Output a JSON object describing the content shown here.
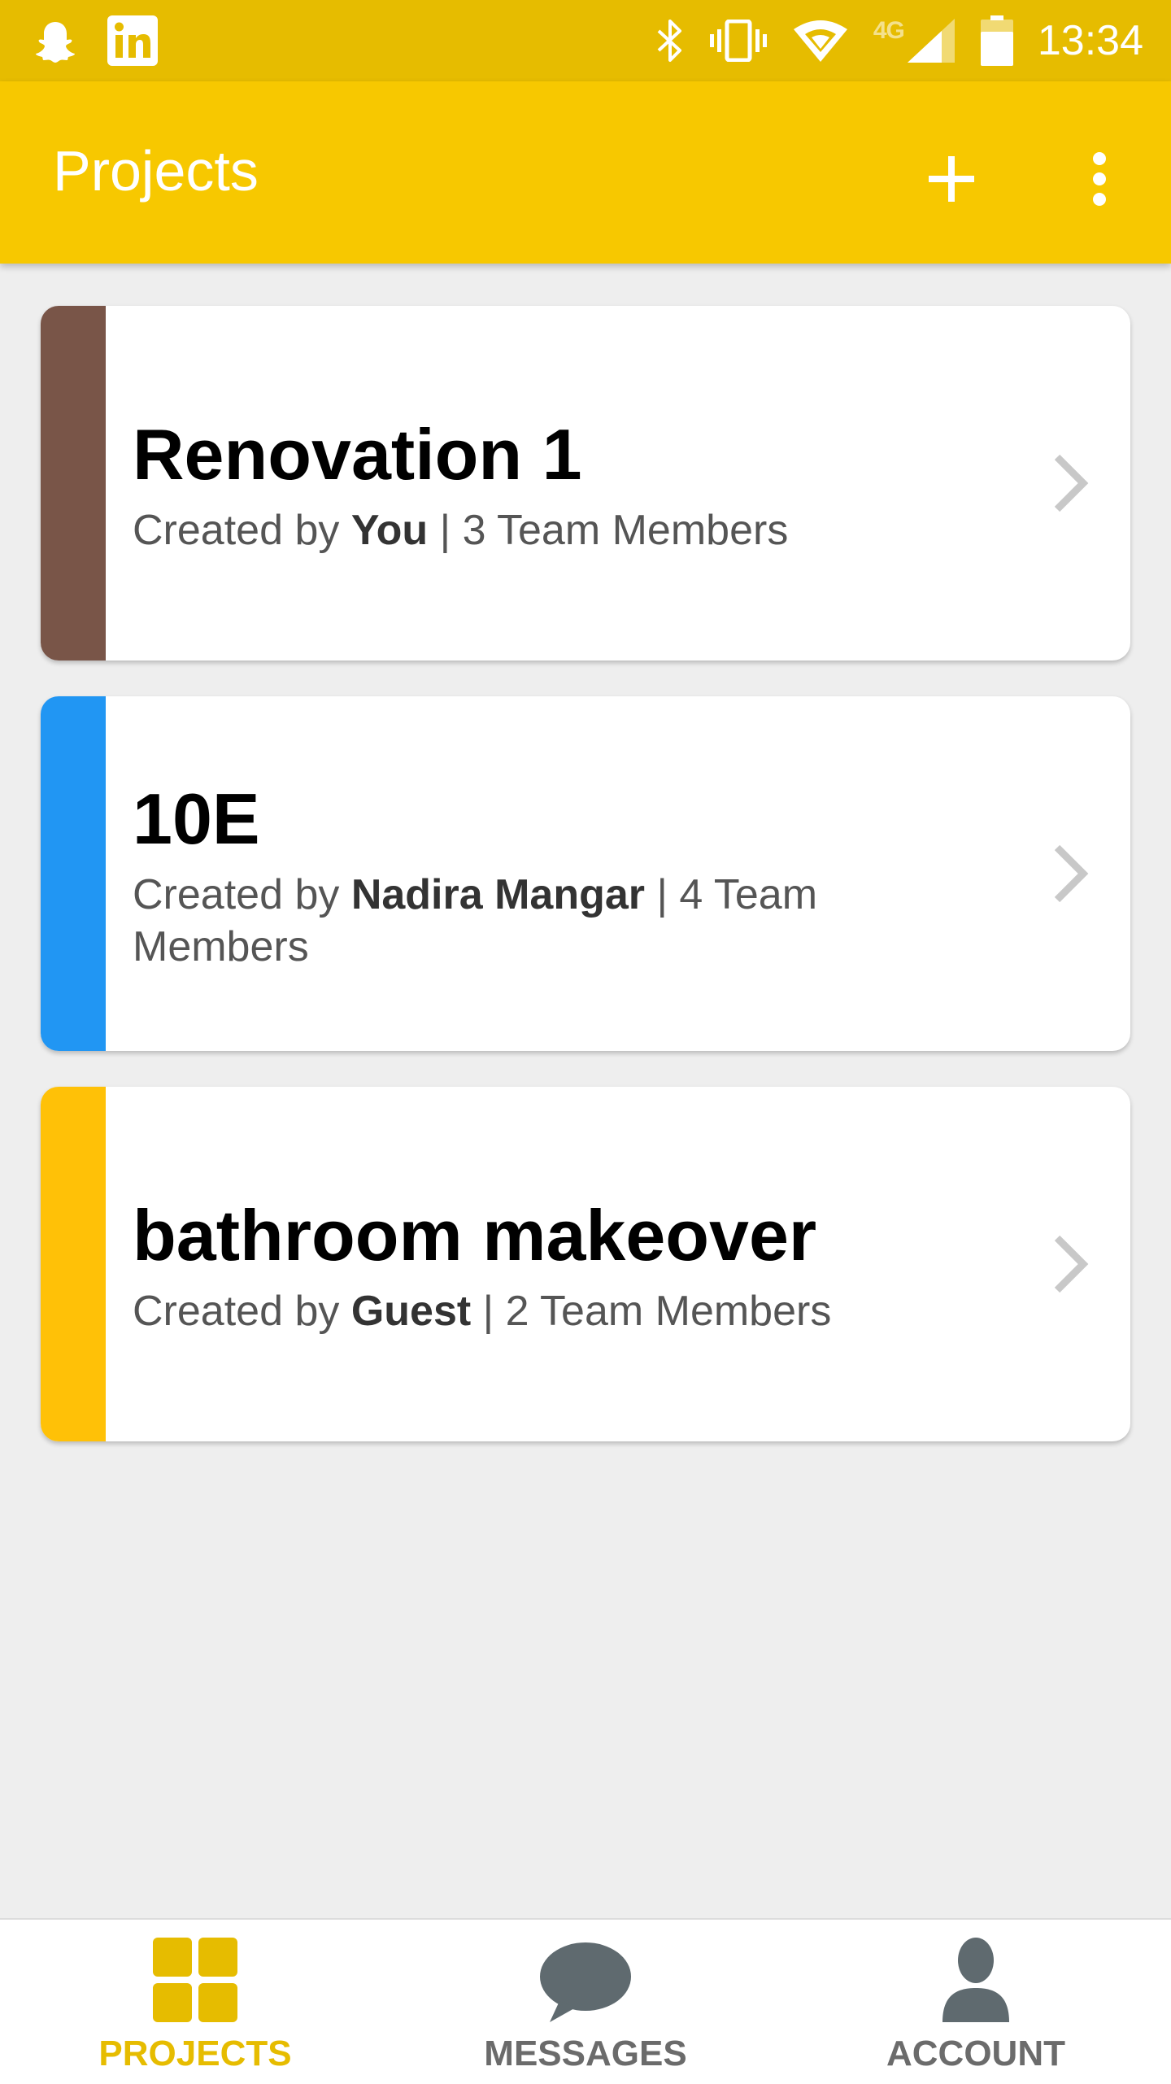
{
  "status_bar": {
    "time": "13:34",
    "network_label": "4G",
    "left_icons": [
      "snapchat-icon",
      "linkedin-icon"
    ],
    "right_icons": [
      "bluetooth-icon",
      "vibrate-icon",
      "wifi-icon",
      "signal-icon",
      "battery-icon"
    ]
  },
  "toolbar": {
    "title": "Projects",
    "add_icon": "plus-icon",
    "menu_icon": "more-vert-icon"
  },
  "colors": {
    "status_bar": "#e6bc00",
    "toolbar": "#f7c800",
    "active_tab": "#e6bc00",
    "inactive_tab": "#6b6b6b"
  },
  "projects": [
    {
      "name": "Renovation 1",
      "created_prefix": "Created by ",
      "creator": "You",
      "members_text": " | 3 Team Members",
      "color": "#795548"
    },
    {
      "name": "10E",
      "created_prefix": "Created by ",
      "creator": "Nadira Mangar",
      "members_text": " | 4 Team Members",
      "color": "#2196f3"
    },
    {
      "name": "bathroom makeover",
      "created_prefix": "Created by ",
      "creator": "Guest",
      "members_text": " | 2 Team Members",
      "color": "#ffc107"
    }
  ],
  "bottom_nav": {
    "tabs": [
      {
        "label": "PROJECTS",
        "icon": "grid-icon",
        "active": true
      },
      {
        "label": "MESSAGES",
        "icon": "chat-bubble-icon",
        "active": false
      },
      {
        "label": "ACCOUNT",
        "icon": "person-icon",
        "active": false
      }
    ]
  }
}
